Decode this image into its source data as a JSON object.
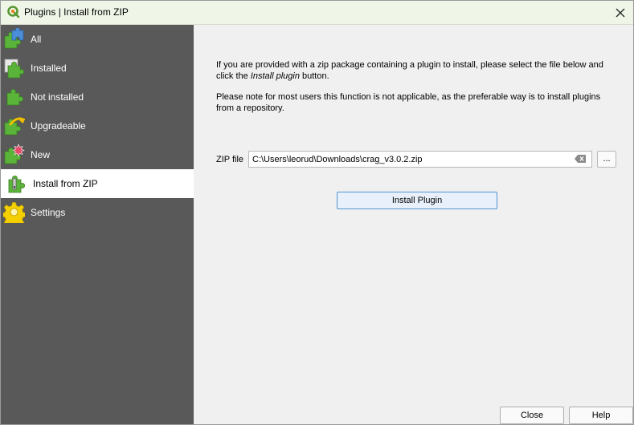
{
  "window": {
    "title": "Plugins | Install from ZIP",
    "logo_icon": "qgis-logo-icon",
    "close_icon": "close-icon"
  },
  "sidebar": {
    "items": [
      {
        "label": "All",
        "icon": "puzzle-all-icon",
        "active": false
      },
      {
        "label": "Installed",
        "icon": "puzzle-installed-icon",
        "active": false
      },
      {
        "label": "Not installed",
        "icon": "puzzle-not-installed-icon",
        "active": false
      },
      {
        "label": "Upgradeable",
        "icon": "puzzle-upgradeable-icon",
        "active": false
      },
      {
        "label": "New",
        "icon": "puzzle-new-icon",
        "active": false
      },
      {
        "label": "Install from ZIP",
        "icon": "install-zip-icon",
        "active": true
      },
      {
        "label": "Settings",
        "icon": "settings-gear-icon",
        "active": false
      }
    ]
  },
  "main": {
    "intro_part1": "If you are provided with a zip package containing a plugin to install, please select the file below and click the ",
    "intro_emph": "Install plugin",
    "intro_part2": " button.",
    "note": "Please note for most users this function is not applicable, as the preferable way is to install plugins from a repository.",
    "zip_label": "ZIP file",
    "zip_value": "C:\\Users\\leorud\\Downloads\\crag_v3.0.2.zip",
    "browse_label": "...",
    "install_label": "Install Plugin"
  },
  "footer": {
    "close_label": "Close",
    "help_label": "Help"
  },
  "colors": {
    "sidebar_bg": "#595959",
    "titlebar_bg": "#eff6e8",
    "accent_border": "#4f93d2",
    "puzzle_green": "#5ab43a",
    "puzzle_blue": "#4a8ed8",
    "gear_yellow": "#f5d000"
  }
}
